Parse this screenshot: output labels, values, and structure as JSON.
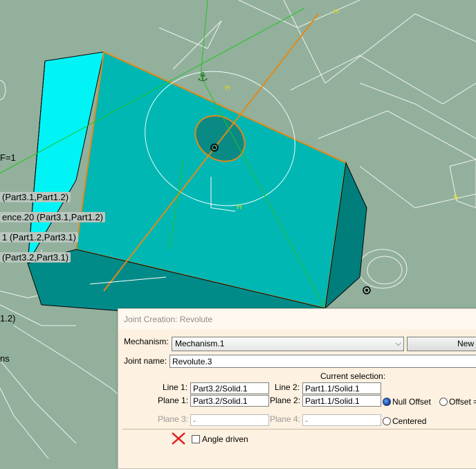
{
  "tree_labels": [
    {
      "text": "F=1"
    },
    {
      "text": "(Part3.1,Part1.2)"
    },
    {
      "text": "ence.20 (Part3.1,Part1.2)"
    },
    {
      "text": "1  (Part1.2,Part3.1)"
    },
    {
      "text": "(Part3.2,Part3.1)"
    },
    {
      "text": "1.2)"
    },
    {
      "text": "ns"
    }
  ],
  "dialog": {
    "title": "Joint Creation: Revolute",
    "mechanism_label": "Mechanism:",
    "mechanism_value": "Mechanism.1",
    "new_button": "New",
    "joint_name_label": "Joint name:",
    "joint_name_value": "Revolute.3",
    "current_selection_label": "Current selection:",
    "line1_label": "Line 1:",
    "line1_value": "Part3.2/Solid.1",
    "line2_label": "Line 2:",
    "line2_value": "Part1.1/Solid.1",
    "plane1_label": "Plane 1:",
    "plane1_value": "Part3.2/Solid.1",
    "plane2_label": "Plane 2:",
    "plane2_value": "Part1.1/Solid.1",
    "null_offset_label": "Null Offset",
    "offset_label": "Offset =",
    "plane3_label": "Plane 3:",
    "plane3_value": "-",
    "plane4_label": "Plane 4:",
    "plane4_value": "-",
    "centered_label": "Centered",
    "angle_driven_label": "Angle driven",
    "null_offset_selected": true,
    "angle_driven_checked": false
  },
  "colors": {
    "background": "#93b09c",
    "part_face_top": "#00b7b3",
    "part_face_side": "#00f4f6",
    "part_face_dark": "#007e7c",
    "edge_highlight": "#e08a1a",
    "constraint_green": "#22c422",
    "dialog_bg": "#fdf1e1"
  }
}
